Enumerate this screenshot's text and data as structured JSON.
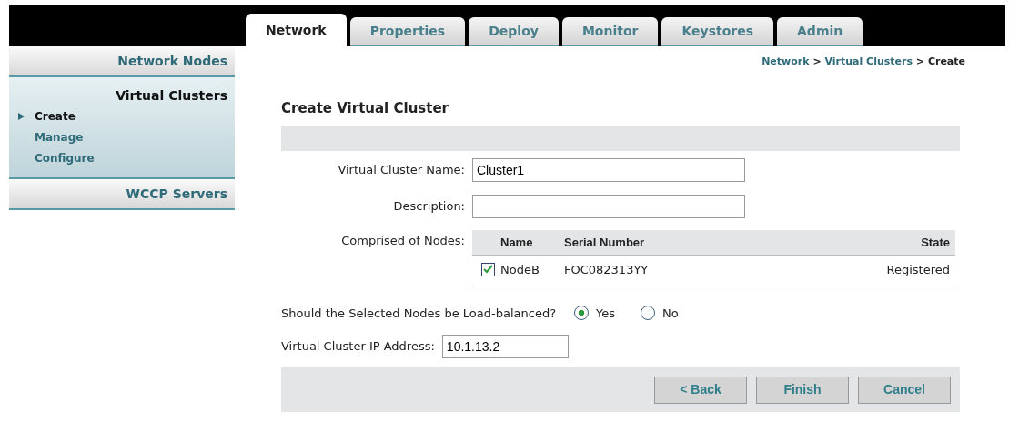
{
  "tabs": [
    {
      "label": "Network",
      "selected": true
    },
    {
      "label": "Properties",
      "selected": false
    },
    {
      "label": "Deploy",
      "selected": false
    },
    {
      "label": "Monitor",
      "selected": false
    },
    {
      "label": "Keystores",
      "selected": false
    },
    {
      "label": "Admin",
      "selected": false
    }
  ],
  "sidebar": {
    "sections": [
      {
        "title": "Network Nodes",
        "expanded": false
      },
      {
        "title": "Virtual Clusters",
        "expanded": true,
        "items": [
          {
            "label": "Create",
            "selected": true
          },
          {
            "label": "Manage",
            "selected": false
          },
          {
            "label": "Configure",
            "selected": false
          }
        ]
      },
      {
        "title": "WCCP Servers",
        "expanded": false
      }
    ]
  },
  "breadcrumb": [
    {
      "label": "Network",
      "kind": "link"
    },
    {
      "label": ">",
      "kind": "separator"
    },
    {
      "label": "Virtual Clusters",
      "kind": "link"
    },
    {
      "label": ">",
      "kind": "separator"
    },
    {
      "label": "Create",
      "kind": "current"
    }
  ],
  "form": {
    "title": "Create Virtual Cluster",
    "name_field": {
      "label": "Virtual Cluster Name:",
      "value": "Cluster1"
    },
    "description_field": {
      "label": "Description:"
    },
    "nodes": {
      "label": "Comprised of Nodes:",
      "columns": [
        "Name",
        "Serial Number",
        "State"
      ],
      "rows": [
        {
          "checked": true,
          "name": "NodeB",
          "serial": "FOC082313YY",
          "state": "Registered"
        }
      ]
    },
    "load_balance": {
      "question": "Should the Selected Nodes be Load-balanced?",
      "options": [
        {
          "label": "Yes",
          "selected": true
        },
        {
          "label": "No",
          "selected": false
        }
      ]
    },
    "ip_field": {
      "label": "Virtual Cluster IP Address:",
      "value": "10.1.13.2"
    },
    "buttons": [
      "< Back",
      "Finish",
      "Cancel"
    ]
  }
}
